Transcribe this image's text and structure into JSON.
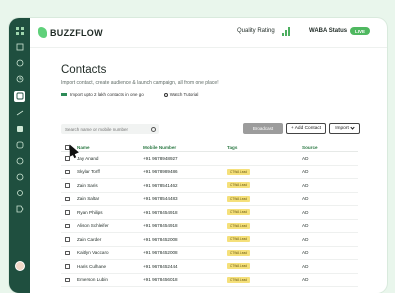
{
  "app": {
    "name": "BUZZFLOW"
  },
  "header": {
    "quality_rating_label": "Quality Rating",
    "waba_status_label": "WABA Status",
    "live_badge": "LIVE"
  },
  "page": {
    "title": "Contacts",
    "subtitle": "Import contact, create audience & launch campaign, all from one place!",
    "import_text": "Import upto 2 lakh contacts in one go",
    "tutorial_text": "Watch Tutorial"
  },
  "toolbar": {
    "search_placeholder": "Search name or mobile number",
    "broadcast_label": "Broadcast",
    "add_contact_label": "+ Add Contact",
    "import_label": "Import"
  },
  "table": {
    "headers": {
      "name": "Name",
      "mobile": "Mobile Number",
      "tags": "Tags",
      "source": "Source"
    },
    "rows": [
      {
        "name": "Jay Anand",
        "mobile": "+91 9678948927",
        "tag": "",
        "source": "AD"
      },
      {
        "name": "Skylar Torff",
        "mobile": "+91 9678989486",
        "tag": "CTWA Lead",
        "source": "AD"
      },
      {
        "name": "Zain Saris",
        "mobile": "+91 9678541462",
        "tag": "CTWA Lead",
        "source": "AD"
      },
      {
        "name": "Zain Saltar",
        "mobile": "+91 9678544483",
        "tag": "CTWA Lead",
        "source": "AD"
      },
      {
        "name": "Ryan Philips",
        "mobile": "+91 9678454918",
        "tag": "CTWA Lead",
        "source": "AD"
      },
      {
        "name": "Alison Schleifer",
        "mobile": "+91 9678454918",
        "tag": "CTWA Lead",
        "source": "AD"
      },
      {
        "name": "Zain Carder",
        "mobile": "+91 9678452008",
        "tag": "CTWA Lead",
        "source": "AD"
      },
      {
        "name": "Kaitlyn Vaccaro",
        "mobile": "+91 9678452008",
        "tag": "CTWA Lead",
        "source": "AD"
      },
      {
        "name": "Haris Culhane",
        "mobile": "+91 9678452444",
        "tag": "CTWA Lead",
        "source": "AD"
      },
      {
        "name": "Emerson Lubin",
        "mobile": "+91 9678456018",
        "tag": "CTWA Lead",
        "source": "AD"
      }
    ]
  },
  "colors": {
    "sidebar": "#1f4f3f",
    "accent": "#4fb860",
    "tag_bg": "#f5e07a",
    "header_text": "#2d7a45"
  },
  "sidebar_icons": [
    "grid-icon",
    "contacts-icon",
    "chat-icon",
    "clock-icon",
    "audience-icon",
    "broadcast-icon",
    "facebook-icon",
    "instagram-icon",
    "help-icon",
    "whatsapp-icon",
    "settings-icon",
    "tag-icon"
  ]
}
